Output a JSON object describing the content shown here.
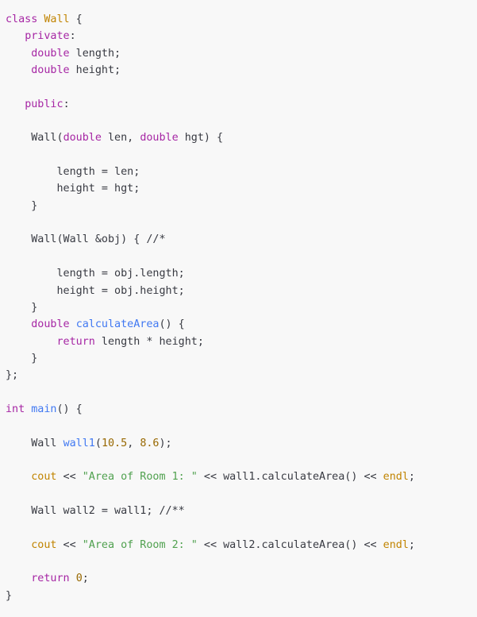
{
  "code_block": {
    "language": "cpp",
    "lines": [
      [
        {
          "t": "class ",
          "c": "kw"
        },
        {
          "t": "Wall",
          "c": "cls"
        },
        {
          "t": " {",
          "c": "plain"
        }
      ],
      [
        {
          "t": "   ",
          "c": "plain"
        },
        {
          "t": "private",
          "c": "kw"
        },
        {
          "t": ":",
          "c": "plain"
        }
      ],
      [
        {
          "t": "    ",
          "c": "plain"
        },
        {
          "t": "double",
          "c": "kw"
        },
        {
          "t": " length;",
          "c": "plain"
        }
      ],
      [
        {
          "t": "    ",
          "c": "plain"
        },
        {
          "t": "double",
          "c": "kw"
        },
        {
          "t": " height;",
          "c": "plain"
        }
      ],
      [],
      [
        {
          "t": "   ",
          "c": "plain"
        },
        {
          "t": "public",
          "c": "kw"
        },
        {
          "t": ":",
          "c": "plain"
        }
      ],
      [],
      [
        {
          "t": "    Wall(",
          "c": "plain"
        },
        {
          "t": "double",
          "c": "kw"
        },
        {
          "t": " len, ",
          "c": "plain"
        },
        {
          "t": "double",
          "c": "kw"
        },
        {
          "t": " hgt) {",
          "c": "plain"
        }
      ],
      [],
      [
        {
          "t": "        length = len;",
          "c": "plain"
        }
      ],
      [
        {
          "t": "        height = hgt;",
          "c": "plain"
        }
      ],
      [
        {
          "t": "    }",
          "c": "plain"
        }
      ],
      [],
      [
        {
          "t": "    Wall(Wall &obj) { //*",
          "c": "plain"
        }
      ],
      [],
      [
        {
          "t": "        length = obj.length;",
          "c": "plain"
        }
      ],
      [
        {
          "t": "        height = obj.height;",
          "c": "plain"
        }
      ],
      [
        {
          "t": "    }",
          "c": "plain"
        }
      ],
      [
        {
          "t": "    ",
          "c": "plain"
        },
        {
          "t": "double",
          "c": "kw"
        },
        {
          "t": " ",
          "c": "plain"
        },
        {
          "t": "calculateArea",
          "c": "fn"
        },
        {
          "t": "() {",
          "c": "plain"
        }
      ],
      [
        {
          "t": "        ",
          "c": "plain"
        },
        {
          "t": "return",
          "c": "kw"
        },
        {
          "t": " length * height;",
          "c": "plain"
        }
      ],
      [
        {
          "t": "    }",
          "c": "plain"
        }
      ],
      [
        {
          "t": "};",
          "c": "plain"
        }
      ],
      [],
      [
        {
          "t": "int",
          "c": "kw"
        },
        {
          "t": " ",
          "c": "plain"
        },
        {
          "t": "main",
          "c": "fn"
        },
        {
          "t": "() {",
          "c": "plain"
        }
      ],
      [],
      [
        {
          "t": "    Wall ",
          "c": "plain"
        },
        {
          "t": "wall1",
          "c": "fn"
        },
        {
          "t": "(",
          "c": "plain"
        },
        {
          "t": "10.5",
          "c": "num"
        },
        {
          "t": ", ",
          "c": "plain"
        },
        {
          "t": "8.6",
          "c": "num"
        },
        {
          "t": ");",
          "c": "plain"
        }
      ],
      [],
      [
        {
          "t": "    ",
          "c": "plain"
        },
        {
          "t": "cout",
          "c": "lib"
        },
        {
          "t": " << ",
          "c": "plain"
        },
        {
          "t": "\"Area of Room 1: \"",
          "c": "str"
        },
        {
          "t": " << wall1.calculateArea() << ",
          "c": "plain"
        },
        {
          "t": "endl",
          "c": "lib"
        },
        {
          "t": ";",
          "c": "plain"
        }
      ],
      [],
      [
        {
          "t": "    Wall wall2 = wall1; //**",
          "c": "plain"
        }
      ],
      [],
      [
        {
          "t": "    ",
          "c": "plain"
        },
        {
          "t": "cout",
          "c": "lib"
        },
        {
          "t": " << ",
          "c": "plain"
        },
        {
          "t": "\"Area of Room 2: \"",
          "c": "str"
        },
        {
          "t": " << wall2.calculateArea() << ",
          "c": "plain"
        },
        {
          "t": "endl",
          "c": "lib"
        },
        {
          "t": ";",
          "c": "plain"
        }
      ],
      [],
      [
        {
          "t": "    ",
          "c": "plain"
        },
        {
          "t": "return",
          "c": "kw"
        },
        {
          "t": " ",
          "c": "plain"
        },
        {
          "t": "0",
          "c": "num"
        },
        {
          "t": ";",
          "c": "plain"
        }
      ],
      [
        {
          "t": "}",
          "c": "plain"
        }
      ]
    ]
  },
  "colors": {
    "background": "#f8f8f8",
    "keyword": "#a626a4",
    "class_name": "#c18401",
    "function": "#4078f2",
    "string": "#50a14f",
    "number": "#986801",
    "text": "#383a42"
  }
}
